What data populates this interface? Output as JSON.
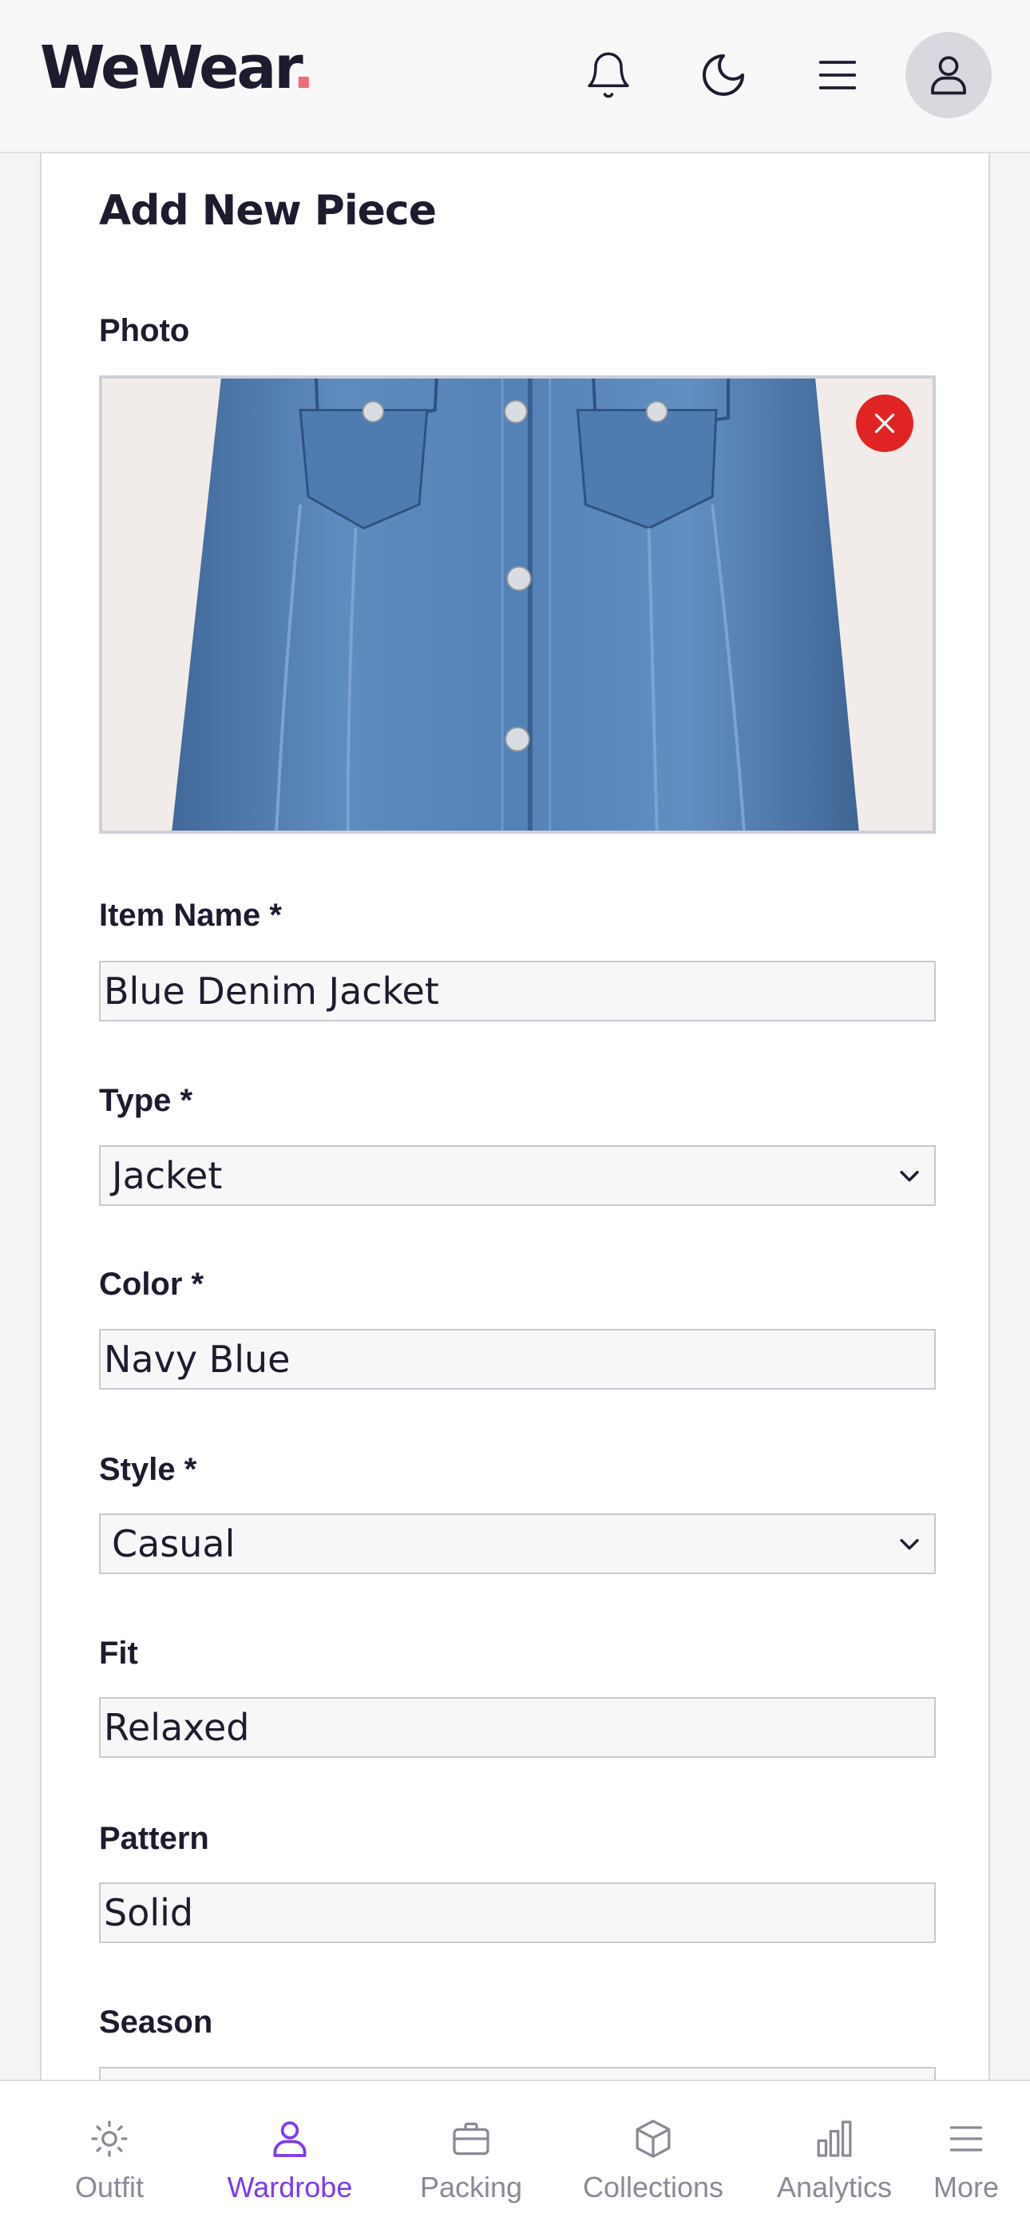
{
  "header": {
    "logo_text": "WeWear",
    "logo_dot": ".",
    "accent_color": "#f06c7a",
    "icons": [
      "bell-icon",
      "moon-icon",
      "menu-icon",
      "user-icon"
    ]
  },
  "form": {
    "title": "Add New Piece",
    "photo_label": "Photo",
    "photo_icon": "remove-photo-icon",
    "fields": {
      "item_name": {
        "label": "Item Name *",
        "value": "Blue Denim Jacket"
      },
      "type": {
        "label": "Type *",
        "value": "Jacket"
      },
      "color": {
        "label": "Color *",
        "value": "Navy Blue"
      },
      "style": {
        "label": "Style *",
        "value": "Casual"
      },
      "fit": {
        "label": "Fit",
        "value": "Relaxed"
      },
      "pattern": {
        "label": "Pattern",
        "value": "Solid"
      },
      "season": {
        "label": "Season",
        "value": ""
      }
    }
  },
  "bottom_nav": {
    "active_color": "#7c3aed",
    "items": [
      {
        "label": "Outfit",
        "icon": "sun-icon",
        "active": false
      },
      {
        "label": "Wardrobe",
        "icon": "person-icon",
        "active": true
      },
      {
        "label": "Packing",
        "icon": "briefcase-icon",
        "active": false
      },
      {
        "label": "Collections",
        "icon": "cube-icon",
        "active": false
      },
      {
        "label": "Analytics",
        "icon": "bar-chart-icon",
        "active": false
      },
      {
        "label": "More",
        "icon": "menu-icon",
        "active": false
      }
    ]
  }
}
